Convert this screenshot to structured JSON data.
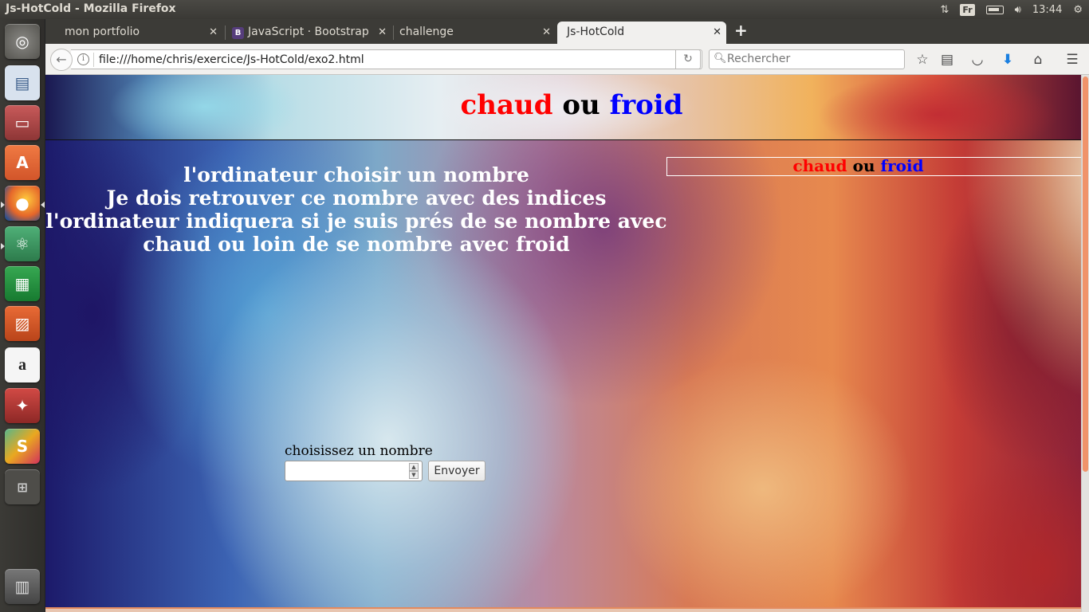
{
  "os": {
    "window_title": "Js-HotCold - Mozilla Firefox",
    "keyboard_layout": "Fr",
    "clock": "13:44"
  },
  "launcher": {
    "items": [
      {
        "name": "dash-home",
        "glyph": "◎",
        "color": "#6b6a66"
      },
      {
        "name": "text-editor",
        "glyph": "▤",
        "color": "#c8d4e4"
      },
      {
        "name": "file-manager",
        "glyph": "▭",
        "color": "#9e4b4b"
      },
      {
        "name": "software-center",
        "glyph": "A",
        "color": "#e0663a"
      },
      {
        "name": "firefox",
        "glyph": "●",
        "color": "#e1692a"
      },
      {
        "name": "atom",
        "glyph": "⚛",
        "color": "#3f8e5e"
      },
      {
        "name": "calc",
        "glyph": "▦",
        "color": "#1f8f3a"
      },
      {
        "name": "impress",
        "glyph": "▨",
        "color": "#c74e21"
      },
      {
        "name": "amazon",
        "glyph": "a",
        "color": "#f3f3f3"
      },
      {
        "name": "system-settings",
        "glyph": "✦",
        "color": "#bb3a36"
      },
      {
        "name": "slack",
        "glyph": "S",
        "color": "#4b9a72"
      },
      {
        "name": "workspace-switcher",
        "glyph": "⊞",
        "color": "#555"
      },
      {
        "name": "trash",
        "glyph": "▥",
        "color": "#888"
      }
    ]
  },
  "browser": {
    "tabs": [
      {
        "label": "mon portfolio",
        "active": false
      },
      {
        "label": "JavaScript · Bootstrap",
        "active": false,
        "favicon": "B"
      },
      {
        "label": "challenge",
        "active": false
      },
      {
        "label": "Js-HotCold",
        "active": true
      }
    ],
    "url": "file:///home/chris/exercice/Js-HotCold/exo2.html",
    "search_placeholder": "Rechercher"
  },
  "page": {
    "header": {
      "hot": "chaud",
      "or": "ou",
      "cold": "froid"
    },
    "rules": [
      "l'ordinateur choisir un nombre",
      "Je dois retrouver ce nombre avec des indices",
      "l'ordinateur indiquera si je suis prés de se nombre avec chaud ou loin de se nombre avec froid"
    ],
    "side_box": {
      "hot": "chaud",
      "or": "ou",
      "cold": "froid"
    },
    "form": {
      "label": "choisissez un nombre",
      "input_value": "",
      "submit_label": "Envoyer"
    }
  }
}
